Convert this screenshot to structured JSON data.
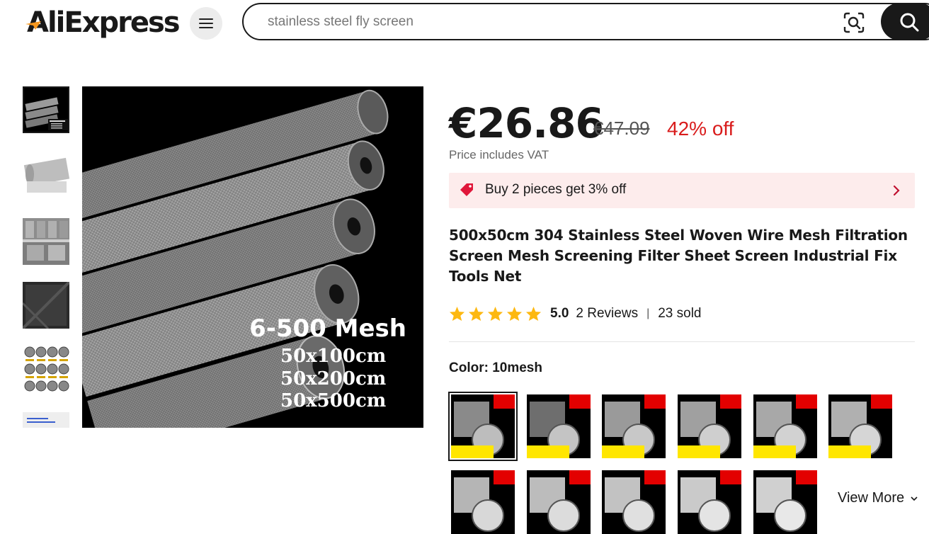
{
  "header": {
    "logo_text": "AliExpress",
    "search_value": "",
    "search_placeholder": "stainless steel fly screen"
  },
  "gallery": {
    "main_caption_title": "6-500 Mesh",
    "main_caption_sizes": [
      "50x100cm",
      "50x200cm",
      "50x500cm"
    ]
  },
  "product": {
    "price": "€26.86",
    "original_price": "€47.09",
    "discount": "42% off",
    "vat_note": "Price includes VAT",
    "promo": "Buy 2 pieces get 3% off",
    "title": "500x50cm 304 Stainless Steel Woven Wire Mesh Filtration Screen Mesh Screening Filter Sheet Screen Industrial Fix Tools Net",
    "rating": "5.0",
    "reviews": "2 Reviews",
    "separator": "|",
    "sold": "23 sold",
    "star_count": 5,
    "color_label": "Color: 10mesh",
    "view_more": "View More"
  },
  "colors": {
    "brand_red": "#d91c1c",
    "star_yellow": "#fdb810",
    "promo_bg": "#fdecec",
    "text_dark": "#191919"
  }
}
